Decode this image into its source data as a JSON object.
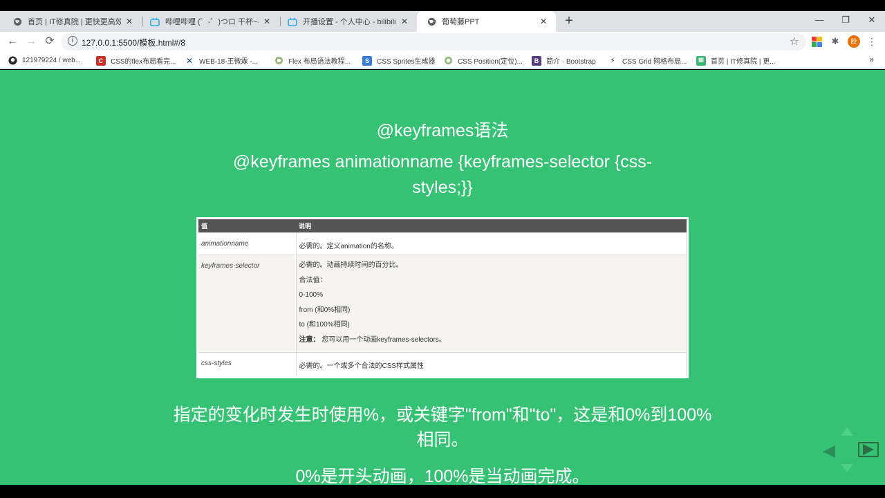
{
  "browser": {
    "tabs": [
      {
        "title": "首页 | IT修真院 | 更快更高效的免费学习",
        "icon": "globe-icon",
        "active": false
      },
      {
        "title": "哔哩哔哩 (゜-゜)つロ 干杯~-bilibili",
        "icon": "bilibili-icon",
        "active": false
      },
      {
        "title": "开播设置 - 个人中心 - bilibili link",
        "icon": "bilibili-icon",
        "active": false
      },
      {
        "title": "葡萄藤PPT",
        "icon": "globe-icon",
        "active": true
      }
    ],
    "new_tab": "+",
    "window_controls": {
      "minimize": "—",
      "maximize": "❐",
      "close": "✕"
    },
    "url": "127.0.0.1:5500/模板.html#/8",
    "profile_initial": "胶",
    "bookmarks": [
      {
        "label": "121979224 / web...",
        "icon": "github-icon"
      },
      {
        "label": "CSS的flex布局看完...",
        "icon": "csdn-icon"
      },
      {
        "label": "WEB-18-王微霖 -...",
        "icon": "x-logo-icon"
      },
      {
        "label": "Flex 布局语法教程...",
        "icon": "runoob-icon"
      },
      {
        "label": "CSS Sprites生成器",
        "icon": "sprites-icon"
      },
      {
        "label": "CSS Position(定位)...",
        "icon": "runoob-icon"
      },
      {
        "label": "简介 · Bootstrap",
        "icon": "bootstrap-icon"
      },
      {
        "label": "CSS Grid 网格布局...",
        "icon": "runner-icon"
      },
      {
        "label": "首页 | IT修真院 | 更...",
        "icon": "itxzy-icon"
      }
    ],
    "bookmarks_more": "»"
  },
  "slide": {
    "background": "#35c275",
    "title": "@keyframes语法",
    "syntax": "@keyframes animationname {keyframes-selector {css-styles;}}",
    "table": {
      "headers": [
        "值",
        "说明"
      ],
      "rows": [
        {
          "value": "animationname",
          "lines": [
            "必需的。定义animation的名称。"
          ]
        },
        {
          "value": "keyframes-selector",
          "lines": [
            "必需的。动画持续时间的百分比。",
            "合法值：",
            "0-100%",
            "from (和0%相同)",
            "to (和100%相同)"
          ],
          "note_label": "注意：",
          "note": "您可以用一个动画keyframes-selectors。"
        },
        {
          "value": "css-styles",
          "lines": [
            "必需的。一个或多个合法的CSS样式属性"
          ]
        }
      ]
    },
    "desc1": "指定的变化时发生时使用%，或关键字\"from\"和\"to\"，这是和0%到100%相同。",
    "desc2": "0%是开头动画，100%是当动画完成。"
  }
}
